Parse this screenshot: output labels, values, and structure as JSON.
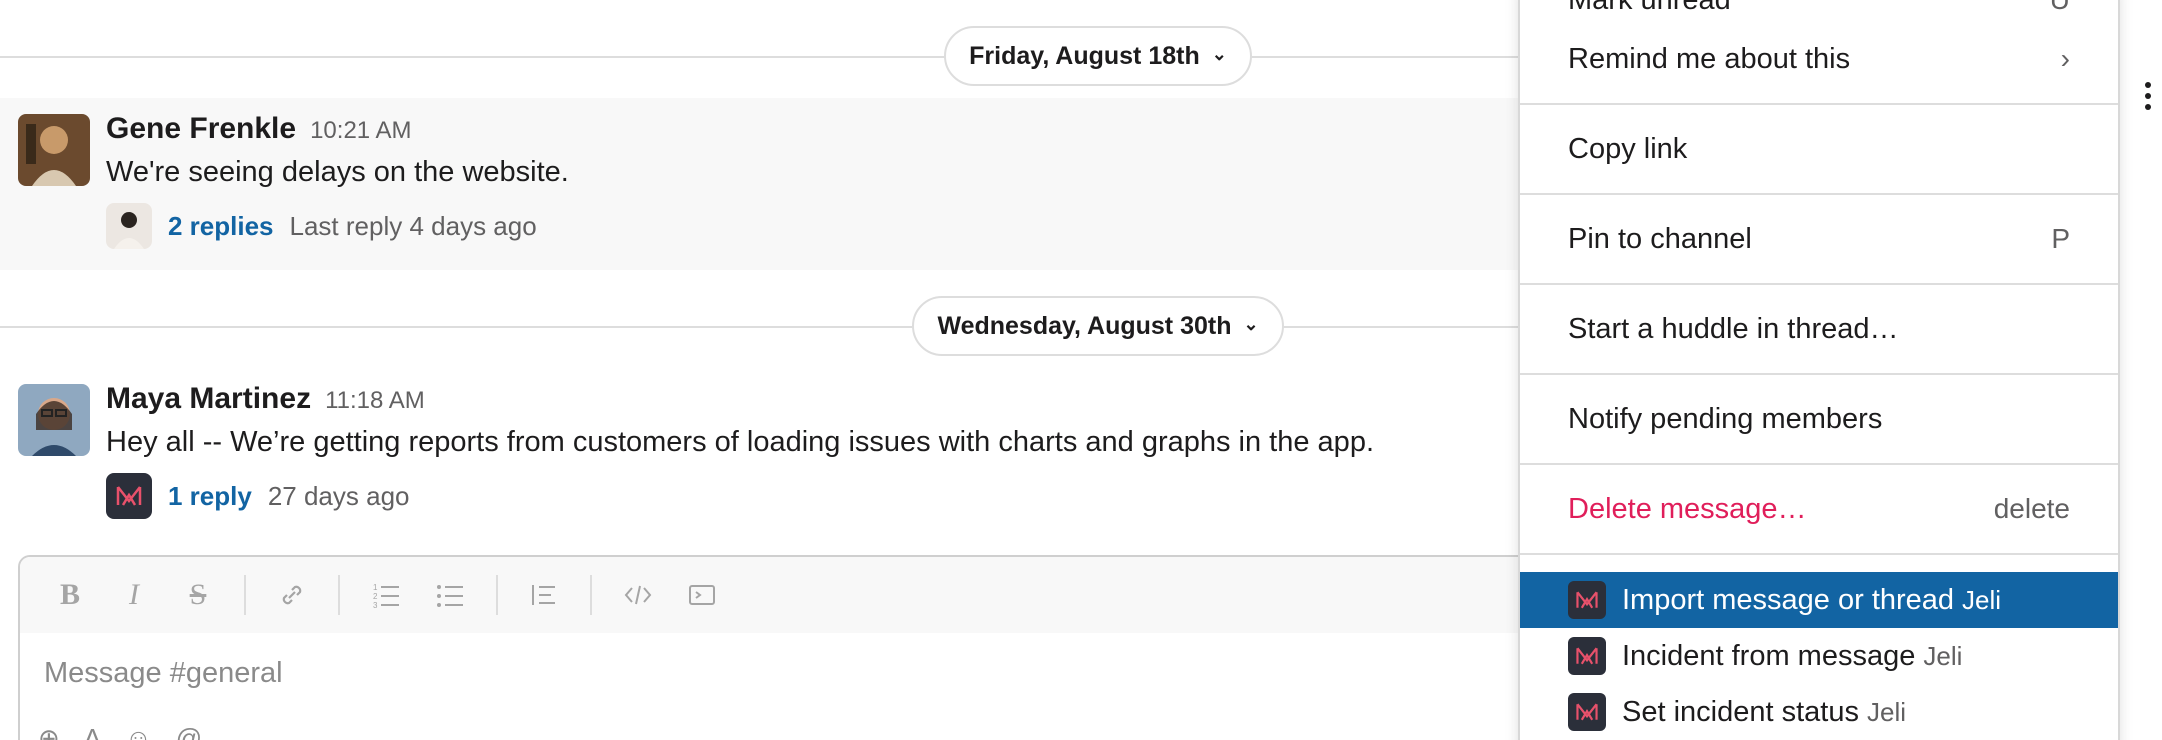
{
  "dividers": [
    {
      "label": "Friday, August 18th"
    },
    {
      "label": "Wednesday, August 30th"
    }
  ],
  "messages": [
    {
      "author": "Gene Frenkle",
      "time": "10:21 AM",
      "text": "We're seeing delays on the website.",
      "replies": "2 replies",
      "reply_meta": "Last reply 4 days ago"
    },
    {
      "author": "Maya Martinez",
      "time": "11:18 AM",
      "text": "Hey all -- We’re getting reports from customers of loading issues with charts and graphs in the app.",
      "replies": "1 reply",
      "reply_meta": "27 days ago"
    }
  ],
  "composer": {
    "placeholder": "Message #general",
    "toolbar": [
      "bold-icon",
      "italic-icon",
      "strikethrough-icon",
      "link-icon",
      "ordered-list-icon",
      "bulleted-list-icon",
      "blockquote-icon",
      "code-icon",
      "code-block-icon"
    ]
  },
  "menu": {
    "items": [
      {
        "label": "Mark unread",
        "shortcut": "U"
      },
      {
        "label": "Remind me about this",
        "shortcut": "›"
      },
      {
        "label": "Copy link",
        "shortcut": ""
      },
      {
        "label": "Pin to channel",
        "shortcut": "P"
      },
      {
        "label": "Start a huddle in thread…",
        "shortcut": ""
      },
      {
        "label": "Notify pending members",
        "shortcut": ""
      },
      {
        "label": "Delete message…",
        "shortcut": "delete"
      }
    ],
    "apps": [
      {
        "label": "Import message or thread",
        "app": "Jeli"
      },
      {
        "label": "Incident from message",
        "app": "Jeli"
      },
      {
        "label": "Set incident status",
        "app": "Jeli"
      }
    ]
  },
  "colors": {
    "link": "#1264a3",
    "danger": "#e01e5a",
    "highlight": "#1264a3",
    "app_icon_bg": "#2b2f3a",
    "app_icon_fg": "#e8516b"
  }
}
